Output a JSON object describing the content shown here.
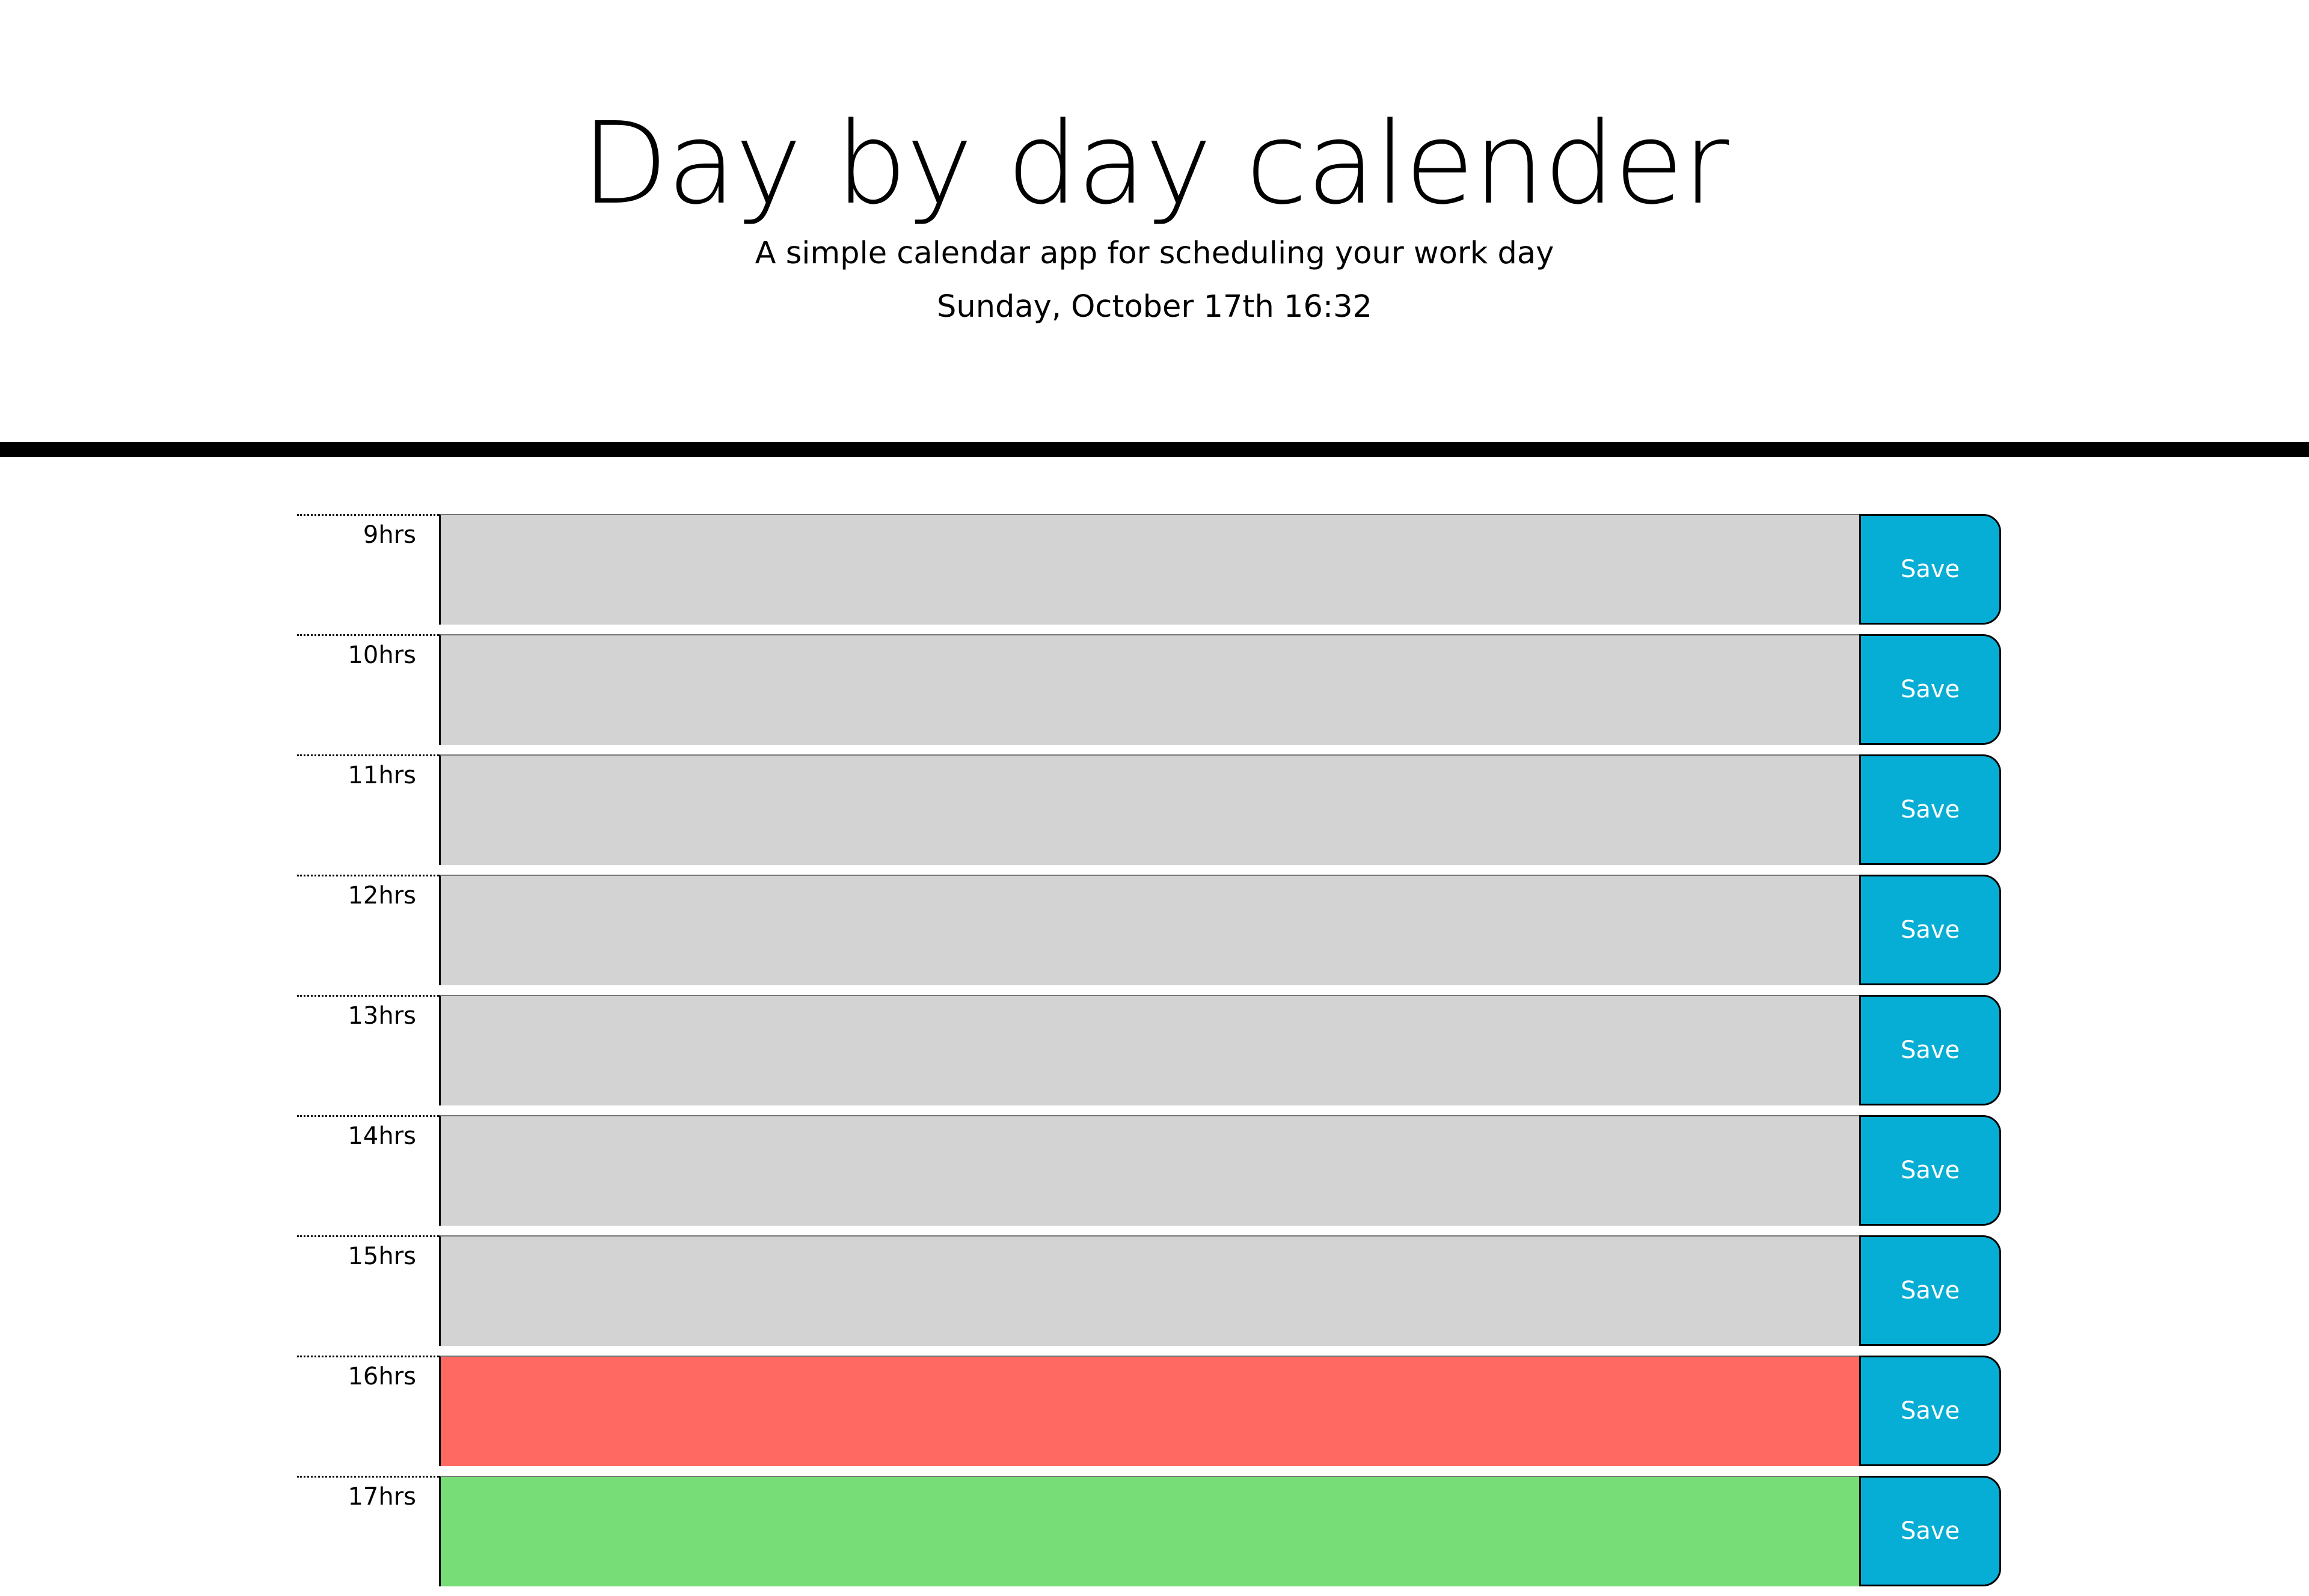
{
  "header": {
    "title": "Day by day calender",
    "subtitle": "A simple calendar app for scheduling your work day",
    "current_date": "Sunday, October 17th 16:32"
  },
  "colors": {
    "past": "#d3d3d3",
    "present": "#ff6961",
    "future": "#77dd77",
    "save_button": "#06aed5"
  },
  "time_blocks": [
    {
      "hour": "9hrs",
      "state": "past",
      "text": "",
      "save_label": "Save"
    },
    {
      "hour": "10hrs",
      "state": "past",
      "text": "",
      "save_label": "Save"
    },
    {
      "hour": "11hrs",
      "state": "past",
      "text": "",
      "save_label": "Save"
    },
    {
      "hour": "12hrs",
      "state": "past",
      "text": "",
      "save_label": "Save"
    },
    {
      "hour": "13hrs",
      "state": "past",
      "text": "",
      "save_label": "Save"
    },
    {
      "hour": "14hrs",
      "state": "past",
      "text": "",
      "save_label": "Save"
    },
    {
      "hour": "15hrs",
      "state": "past",
      "text": "",
      "save_label": "Save"
    },
    {
      "hour": "16hrs",
      "state": "present",
      "text": "",
      "save_label": "Save"
    },
    {
      "hour": "17hrs",
      "state": "future",
      "text": "",
      "save_label": "Save"
    }
  ]
}
